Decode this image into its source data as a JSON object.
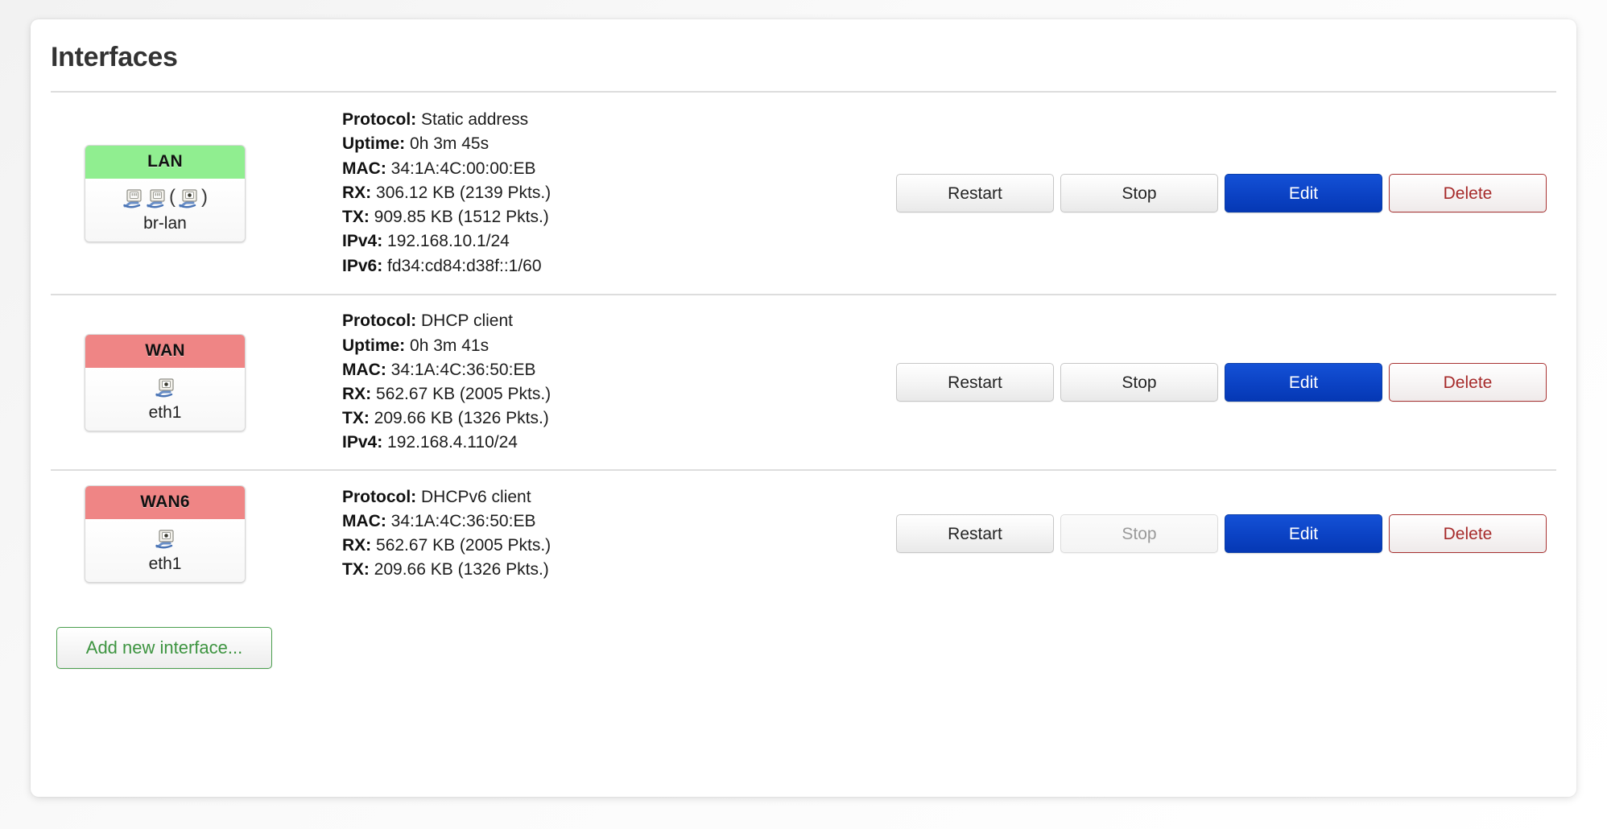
{
  "card": {
    "title": "Interfaces"
  },
  "labels": {
    "protocol": "Protocol:",
    "uptime": "Uptime:",
    "mac": "MAC:",
    "rx": "RX:",
    "tx": "TX:",
    "ipv4": "IPv4:",
    "ipv6": "IPv6:"
  },
  "colors": {
    "lan_badge": "#90ee90",
    "wan_badge": "#ef8585",
    "edit_button": "#0b42c4",
    "delete_text": "#a62a2a",
    "add_button_text": "#3d9440",
    "title_text": "#333333",
    "divider": "#dddddd"
  },
  "interfaces": [
    {
      "name": "LAN",
      "badge_color": "#90ee90",
      "device": "br-lan",
      "device_icons": [
        "ethernet-icon",
        "ethernet-icon",
        "(",
        "ethernet-icon",
        ")"
      ],
      "details": {
        "protocol": "Static address",
        "uptime": "0h 3m 45s",
        "mac": "34:1A:4C:00:00:EB",
        "rx": "306.12 KB (2139 Pkts.)",
        "tx": "909.85 KB (1512 Pkts.)",
        "ipv4": "192.168.10.1/24",
        "ipv6": "fd34:cd84:d38f::1/60"
      },
      "buttons": {
        "restart": "Restart",
        "stop": "Stop",
        "edit": "Edit",
        "delete": "Delete",
        "stop_disabled": false
      }
    },
    {
      "name": "WAN",
      "badge_color": "#ef8585",
      "device": "eth1",
      "device_icons": [
        "ethernet-icon"
      ],
      "details": {
        "protocol": "DHCP client",
        "uptime": "0h 3m 41s",
        "mac": "34:1A:4C:36:50:EB",
        "rx": "562.67 KB (2005 Pkts.)",
        "tx": "209.66 KB (1326 Pkts.)",
        "ipv4": "192.168.4.110/24"
      },
      "buttons": {
        "restart": "Restart",
        "stop": "Stop",
        "edit": "Edit",
        "delete": "Delete",
        "stop_disabled": false
      }
    },
    {
      "name": "WAN6",
      "badge_color": "#ef8585",
      "device": "eth1",
      "device_icons": [
        "ethernet-icon"
      ],
      "details": {
        "protocol": "DHCPv6 client",
        "mac": "34:1A:4C:36:50:EB",
        "rx": "562.67 KB (2005 Pkts.)",
        "tx": "209.66 KB (1326 Pkts.)"
      },
      "buttons": {
        "restart": "Restart",
        "stop": "Stop",
        "edit": "Edit",
        "delete": "Delete",
        "stop_disabled": true
      }
    }
  ],
  "footer": {
    "add_interface": "Add new interface..."
  }
}
